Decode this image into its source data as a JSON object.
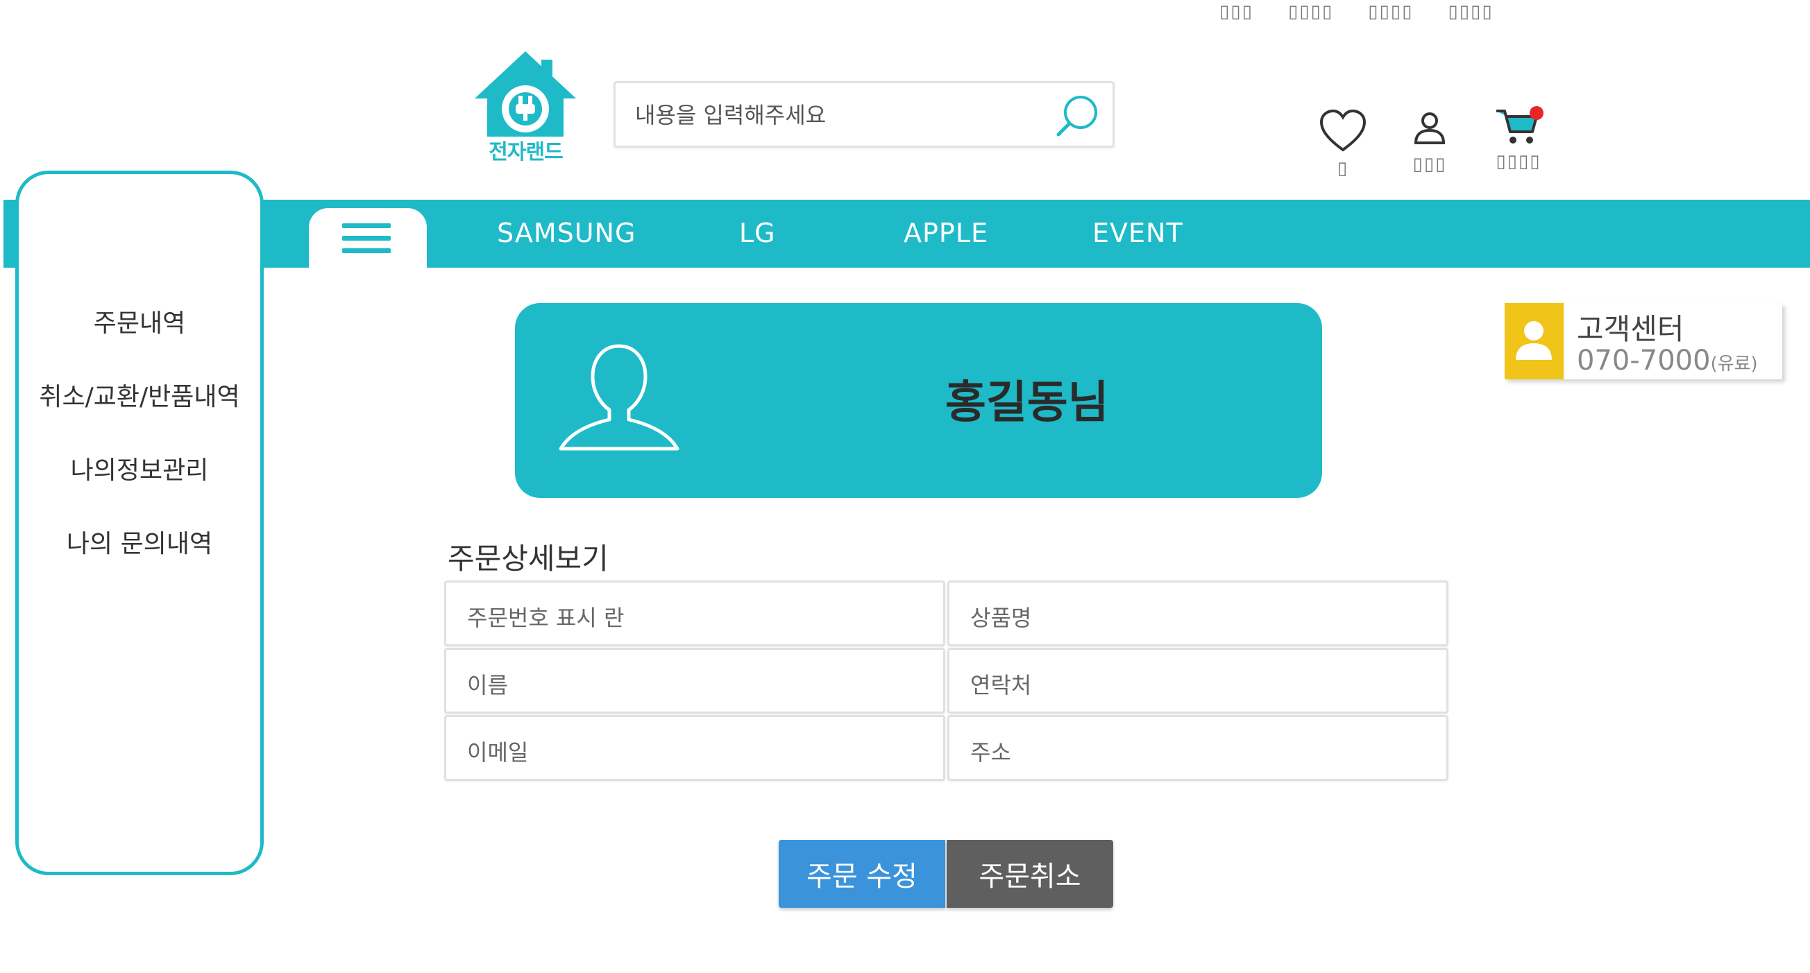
{
  "top_links": [
    "▯▯▯",
    "▯▯▯▯",
    "▯▯▯▯",
    "▯▯▯▯"
  ],
  "logo": {
    "text": "전자랜드"
  },
  "search": {
    "placeholder": "내용을 입력해주세요"
  },
  "header_icons": {
    "wishlist_label": "▯",
    "mypage_label": "▯▯▯",
    "cart_label": "▯▯▯▯"
  },
  "nav": {
    "items": [
      "SAMSUNG",
      "LG",
      "APPLE",
      "EVENT"
    ]
  },
  "sidebar": {
    "items": [
      "주문내역",
      "취소/교환/반품내역",
      "나의정보관리",
      "나의 문의내역"
    ]
  },
  "profile": {
    "name": "홍길동님"
  },
  "customer_center": {
    "title": "고객센터",
    "phone": "070-7000",
    "phone_note": "(유료)"
  },
  "order_detail": {
    "title": "주문상세보기",
    "fields": [
      "주문번호 표시 란",
      "상품명",
      "이름",
      "연락처",
      "이메일",
      "주소"
    ]
  },
  "buttons": {
    "edit": "주문 수정",
    "cancel": "주문취소"
  },
  "colors": {
    "primary": "#1fbac7",
    "edit_button": "#3b93dc",
    "cancel_button": "#5f5f5f",
    "cs_accent": "#f0c419",
    "cart_badge": "#e8262a"
  }
}
